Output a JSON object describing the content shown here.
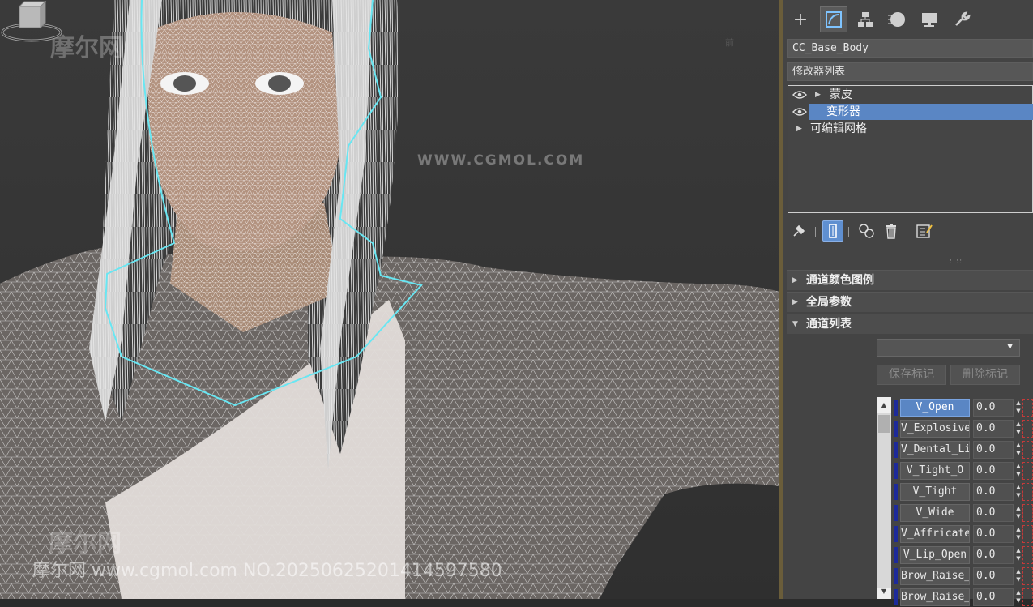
{
  "viewport": {
    "viewcube_label": "前",
    "watermark_url": "WWW.CGMOL.COM",
    "watermark_logo": "摩尔网",
    "watermark_bottom": "摩尔网 www.cgmol.com NO.20250625201414597580"
  },
  "command_panel": {
    "tabs": [
      {
        "icon": "create-plus-icon"
      },
      {
        "icon": "modify-icon",
        "active": true
      },
      {
        "icon": "hierarchy-icon"
      },
      {
        "icon": "motion-icon"
      },
      {
        "icon": "display-icon"
      },
      {
        "icon": "utilities-wrench-icon"
      }
    ],
    "object_name": "CC_Base_Body",
    "modifier_list_label": "修改器列表",
    "stack": [
      {
        "label": "蒙皮",
        "selected": false
      },
      {
        "label": "变形器",
        "selected": true
      },
      {
        "label": "可编辑网格",
        "selected": false
      }
    ],
    "stack_tools": [
      "pin-stack-icon",
      "show-end-result-icon",
      "make-unique-icon",
      "remove-modifier-icon",
      "configure-sets-icon"
    ],
    "rollouts": {
      "channel_color_legend": "通道颜色图例",
      "global_params": "全局参数",
      "channel_list": "通道列表"
    },
    "channel_dropdown_value": "",
    "save_marker_label": "保存标记",
    "delete_marker_label": "删除标记",
    "channels": [
      {
        "name": "V_Open",
        "value": "0.0",
        "selected": true
      },
      {
        "name": "V_Explosive",
        "value": "0.0"
      },
      {
        "name": "V_Dental_Li",
        "value": "0.0"
      },
      {
        "name": "V_Tight_O",
        "value": "0.0"
      },
      {
        "name": "V_Tight",
        "value": "0.0"
      },
      {
        "name": "V_Wide",
        "value": "0.0"
      },
      {
        "name": "V_Affricate",
        "value": "0.0"
      },
      {
        "name": "V_Lip_Open",
        "value": "0.0"
      },
      {
        "name": "Brow_Raise_",
        "value": "0.0"
      },
      {
        "name": "Brow_Raise_",
        "value": "0.0"
      }
    ]
  }
}
